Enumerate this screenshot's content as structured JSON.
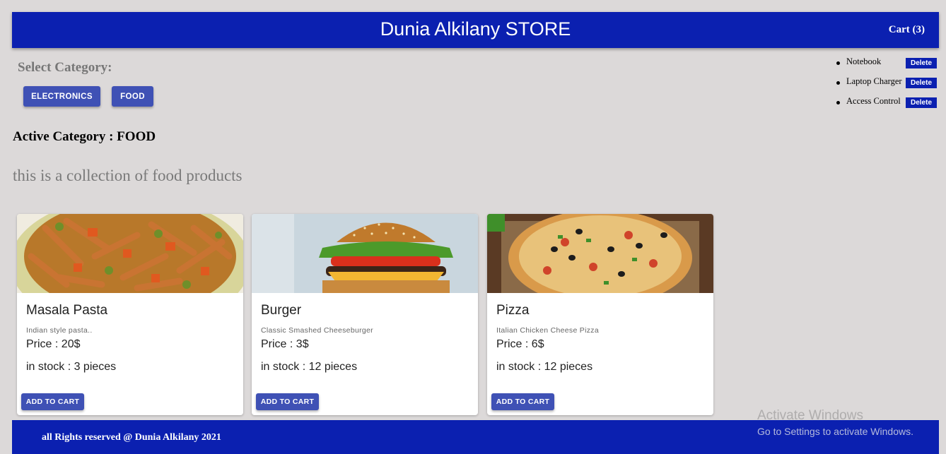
{
  "header": {
    "title": "Dunia Alkilany STORE",
    "cart_label": "Cart (3)"
  },
  "categories": {
    "heading": "Select Category:",
    "buttons": [
      "ELECTRONICS",
      "FOOD"
    ]
  },
  "active_category": {
    "label": "Active Category : FOOD",
    "description": "this is a collection of food products"
  },
  "cart": {
    "items": [
      {
        "name": "Notebook",
        "delete_label": "Delete"
      },
      {
        "name": "Laptop Charger",
        "delete_label": "Delete"
      },
      {
        "name": "Access Control",
        "delete_label": "Delete"
      }
    ]
  },
  "products": [
    {
      "name": "Masala Pasta",
      "description": "Indian style pasta..",
      "price": "Price : 20$",
      "stock": "in stock : 3 pieces",
      "button": "ADD TO CART"
    },
    {
      "name": "Burger",
      "description": "Classic Smashed Cheeseburger",
      "price": "Price : 3$",
      "stock": "in stock : 12 pieces",
      "button": "ADD TO CART"
    },
    {
      "name": "Pizza",
      "description": "Italian Chicken Cheese Pizza",
      "price": "Price : 6$",
      "stock": "in stock : 12 pieces",
      "button": "ADD TO CART"
    }
  ],
  "footer": {
    "text": "all Rights reserved @ Dunia Alkilany 2021"
  },
  "watermark": {
    "title": "Activate Windows",
    "subtitle": "Go to Settings to activate Windows."
  },
  "colors": {
    "header_bg": "#0b20b0",
    "button_bg": "#3f51b5",
    "page_bg": "#dcd9d9"
  }
}
